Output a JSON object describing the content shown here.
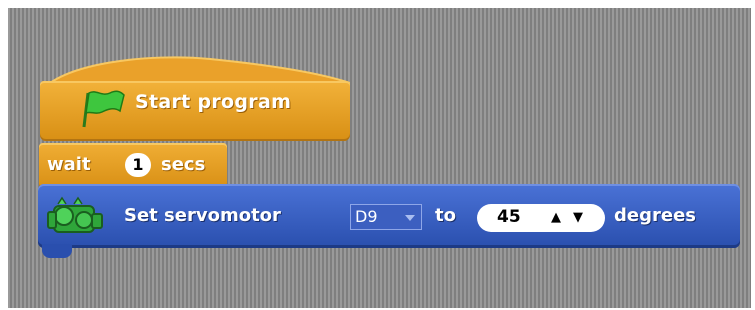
{
  "hat_block": {
    "label": "Start program",
    "icon": "green-flag-icon"
  },
  "wait_block": {
    "prefix": "wait",
    "value": "1",
    "suffix": "secs"
  },
  "servo_block": {
    "prefix": "Set servomotor",
    "port": "D9",
    "to_label": "to",
    "angle": "45",
    "up_glyph": "▲",
    "down_glyph": "▼",
    "suffix": "degrees",
    "icon": "servo-motor-icon"
  },
  "colors": {
    "control_orange": "#e39b1f",
    "motion_blue": "#3b5fc4",
    "flag_green": "#3ec63e"
  }
}
